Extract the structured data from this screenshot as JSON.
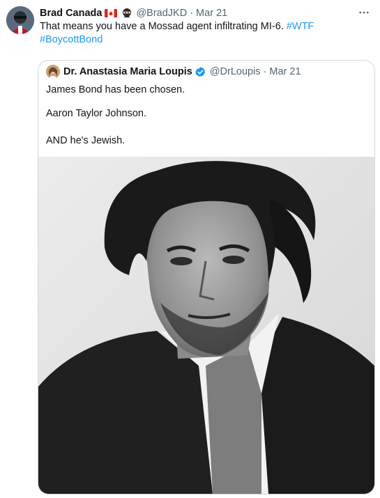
{
  "tweet": {
    "author_name": "Brad Canada",
    "handle": "@BradJKD",
    "separator": "·",
    "date": "Mar 21",
    "text": "That means you have a Mossad agent infiltrating MI-6.",
    "hashtags": [
      "#WTF",
      "#BoycottBond"
    ],
    "icons": {
      "flag": "canada-flag-icon",
      "ninja": "ninja-emoji-icon",
      "more": "more-options-icon"
    }
  },
  "quote": {
    "author_name": "Dr. Anastasia Maria Loupis",
    "handle": "@DrLoupis",
    "separator": "·",
    "date": "Mar 21",
    "lines": [
      "James Bond has been chosen.",
      "Aaron Taylor Johnson.",
      "AND he's Jewish."
    ],
    "icons": {
      "verified": "verified-badge-icon"
    }
  },
  "colors": {
    "link": "#1d9bf0",
    "secondary_text": "#536471",
    "border": "#cfd9de",
    "primary_text": "#0f1419"
  }
}
